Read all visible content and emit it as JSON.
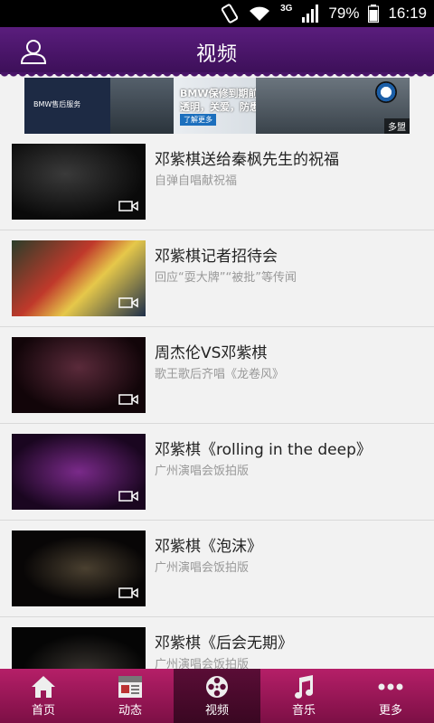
{
  "status": {
    "network": "3G",
    "battery": "79%",
    "time": "16:19"
  },
  "header": {
    "title": "视频"
  },
  "ad": {
    "left_text": "BMW售后服务",
    "line1": "BMW保修到期前免费检测。",
    "line2": "透明，关爱，防患未然。",
    "button": "了解更多",
    "tag": "多盟"
  },
  "videos": [
    {
      "title": "邓紫棋送给秦枫先生的祝福",
      "subtitle": "自弹自唱献祝福"
    },
    {
      "title": "邓紫棋记者招待会",
      "subtitle": "回应“耍大牌”“被批”等传闻"
    },
    {
      "title": "周杰伦VS邓紫棋",
      "subtitle": "歌王歌后齐唱《龙卷风》"
    },
    {
      "title": "邓紫棋《rolling in the deep》",
      "subtitle": "广州演唱会饭拍版"
    },
    {
      "title": "邓紫棋《泡沫》",
      "subtitle": "广州演唱会饭拍版"
    },
    {
      "title": "邓紫棋《后会无期》",
      "subtitle": "广州演唱会饭拍版"
    }
  ],
  "tabs": [
    {
      "label": "首页",
      "icon": "home-icon"
    },
    {
      "label": "动态",
      "icon": "news-icon"
    },
    {
      "label": "视频",
      "icon": "film-reel-icon"
    },
    {
      "label": "音乐",
      "icon": "music-note-icon"
    },
    {
      "label": "更多",
      "icon": "more-dots-icon"
    }
  ],
  "colors": {
    "header": "#4a1569",
    "tabbar": "#a0185a",
    "tab_active": "#4a0a2c"
  }
}
